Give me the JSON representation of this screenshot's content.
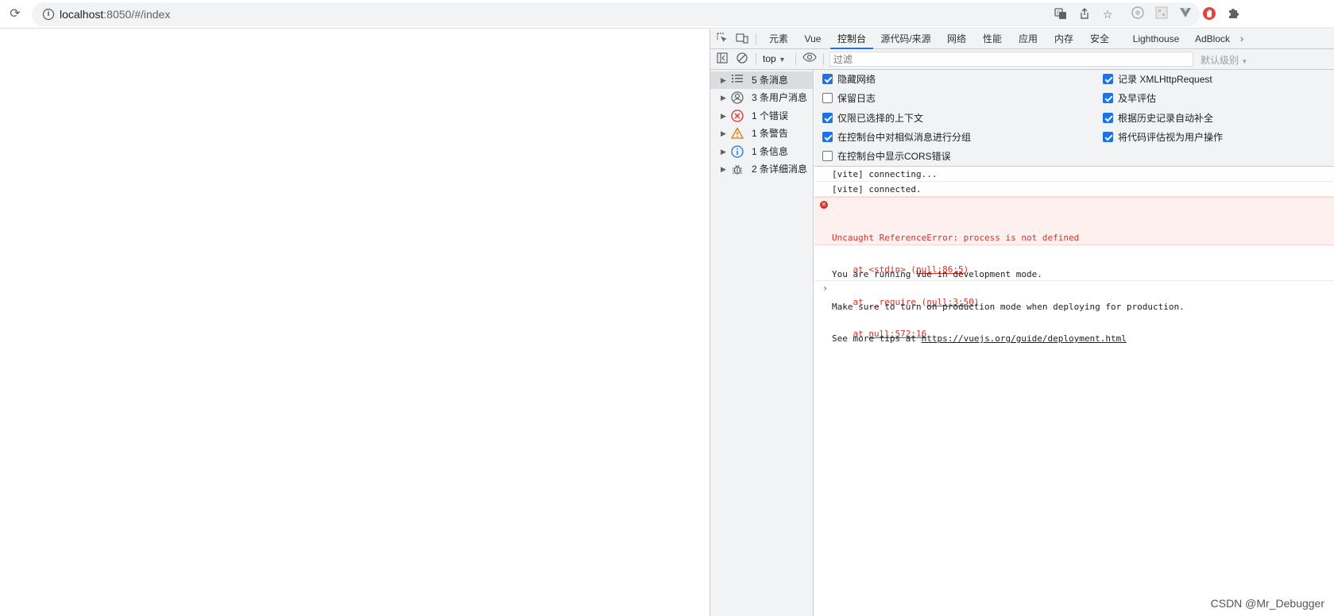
{
  "browser": {
    "url_host": "localhost",
    "url_rest": ":8050/#/index"
  },
  "devtools": {
    "tabs": [
      "元素",
      "Vue",
      "控制台",
      "源代码/来源",
      "网络",
      "性能",
      "应用",
      "内存",
      "安全",
      "Lighthouse",
      "AdBlock"
    ],
    "active_tab": "控制台",
    "toolbar": {
      "context": "top",
      "filter_placeholder": "过滤",
      "levels": "默认级别"
    },
    "sidebar": [
      {
        "label": "5 条消息",
        "icon": "list-icon"
      },
      {
        "label": "3 条用户消息",
        "icon": "user-icon"
      },
      {
        "label": "1 个错误",
        "icon": "error-icon"
      },
      {
        "label": "1 条警告",
        "icon": "warning-icon"
      },
      {
        "label": "1 条信息",
        "icon": "info-icon"
      },
      {
        "label": "2 条详细消息",
        "icon": "bug-icon"
      }
    ],
    "settings_left": [
      {
        "label": "隐藏网络",
        "checked": true
      },
      {
        "label": "保留日志",
        "checked": false
      },
      {
        "label": "仅限已选择的上下文",
        "checked": true
      },
      {
        "label": "在控制台中对相似消息进行分组",
        "checked": true
      },
      {
        "label": "在控制台中显示CORS错误",
        "checked": false
      }
    ],
    "settings_right": [
      {
        "label": "记录 XMLHttpRequest",
        "checked": true
      },
      {
        "label": "及早评估",
        "checked": true
      },
      {
        "label": "根据历史记录自动补全",
        "checked": true
      },
      {
        "label": "将代码评估视为用户操作",
        "checked": true
      }
    ],
    "console": {
      "log1": "[vite] connecting...",
      "log2": "[vite] connected.",
      "error_title": "Uncaught ReferenceError: process is not defined",
      "error_line1_pre": "    at <stdin> (",
      "error_line1_link": "null:86:5",
      "error_line1_post": ")",
      "error_line2_pre": "    at __require (",
      "error_line2_link": "null:3:50",
      "error_line2_post": ")",
      "error_line3_pre": "    at ",
      "error_line3_link": "null:572:16",
      "vue_line1": "You are running Vue in development mode.",
      "vue_line2": "Make sure to turn on production mode when deploying for production.",
      "vue_line3_pre": "See more tips at ",
      "vue_line3_link": "https://vuejs.org/guide/deployment.html"
    }
  },
  "watermark": "CSDN @Mr_Debugger"
}
